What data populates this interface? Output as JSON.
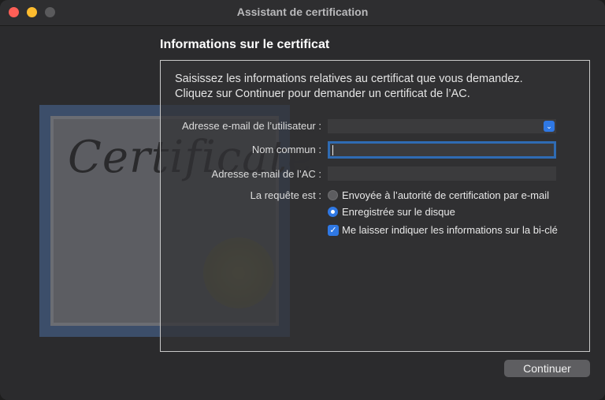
{
  "window": {
    "title": "Assistant de certification"
  },
  "section": {
    "title": "Informations sur le certificat"
  },
  "intro": {
    "line1": "Saisissez les informations relatives au certificat que vous demandez.",
    "line2": "Cliquez sur Continuer pour demander un certificat de l’AC."
  },
  "artwork": {
    "word": "Certificate"
  },
  "form": {
    "user_email_label": "Adresse e-mail de l’utilisateur :",
    "user_email_value": "",
    "common_name_label": "Nom commun :",
    "common_name_value": "",
    "ca_email_label": "Adresse e-mail de l’AC :",
    "ca_email_value": "",
    "request_label": "La requête est :",
    "options": [
      {
        "label": "Envoyée à l’autorité de certification par e-mail",
        "selected": false
      },
      {
        "label": "Enregistrée sur le disque",
        "selected": true
      }
    ],
    "keypair_checkbox_label": "Me laisser indiquer les informations sur la bi-clé",
    "keypair_checked": true
  },
  "buttons": {
    "continue": "Continuer"
  },
  "icons": {
    "select_arrow": "chevron-updown-icon",
    "checkmark": "checkmark-icon"
  },
  "colors": {
    "accent": "#2f78e4",
    "close": "#fe5f57",
    "minimize": "#febc2e"
  }
}
